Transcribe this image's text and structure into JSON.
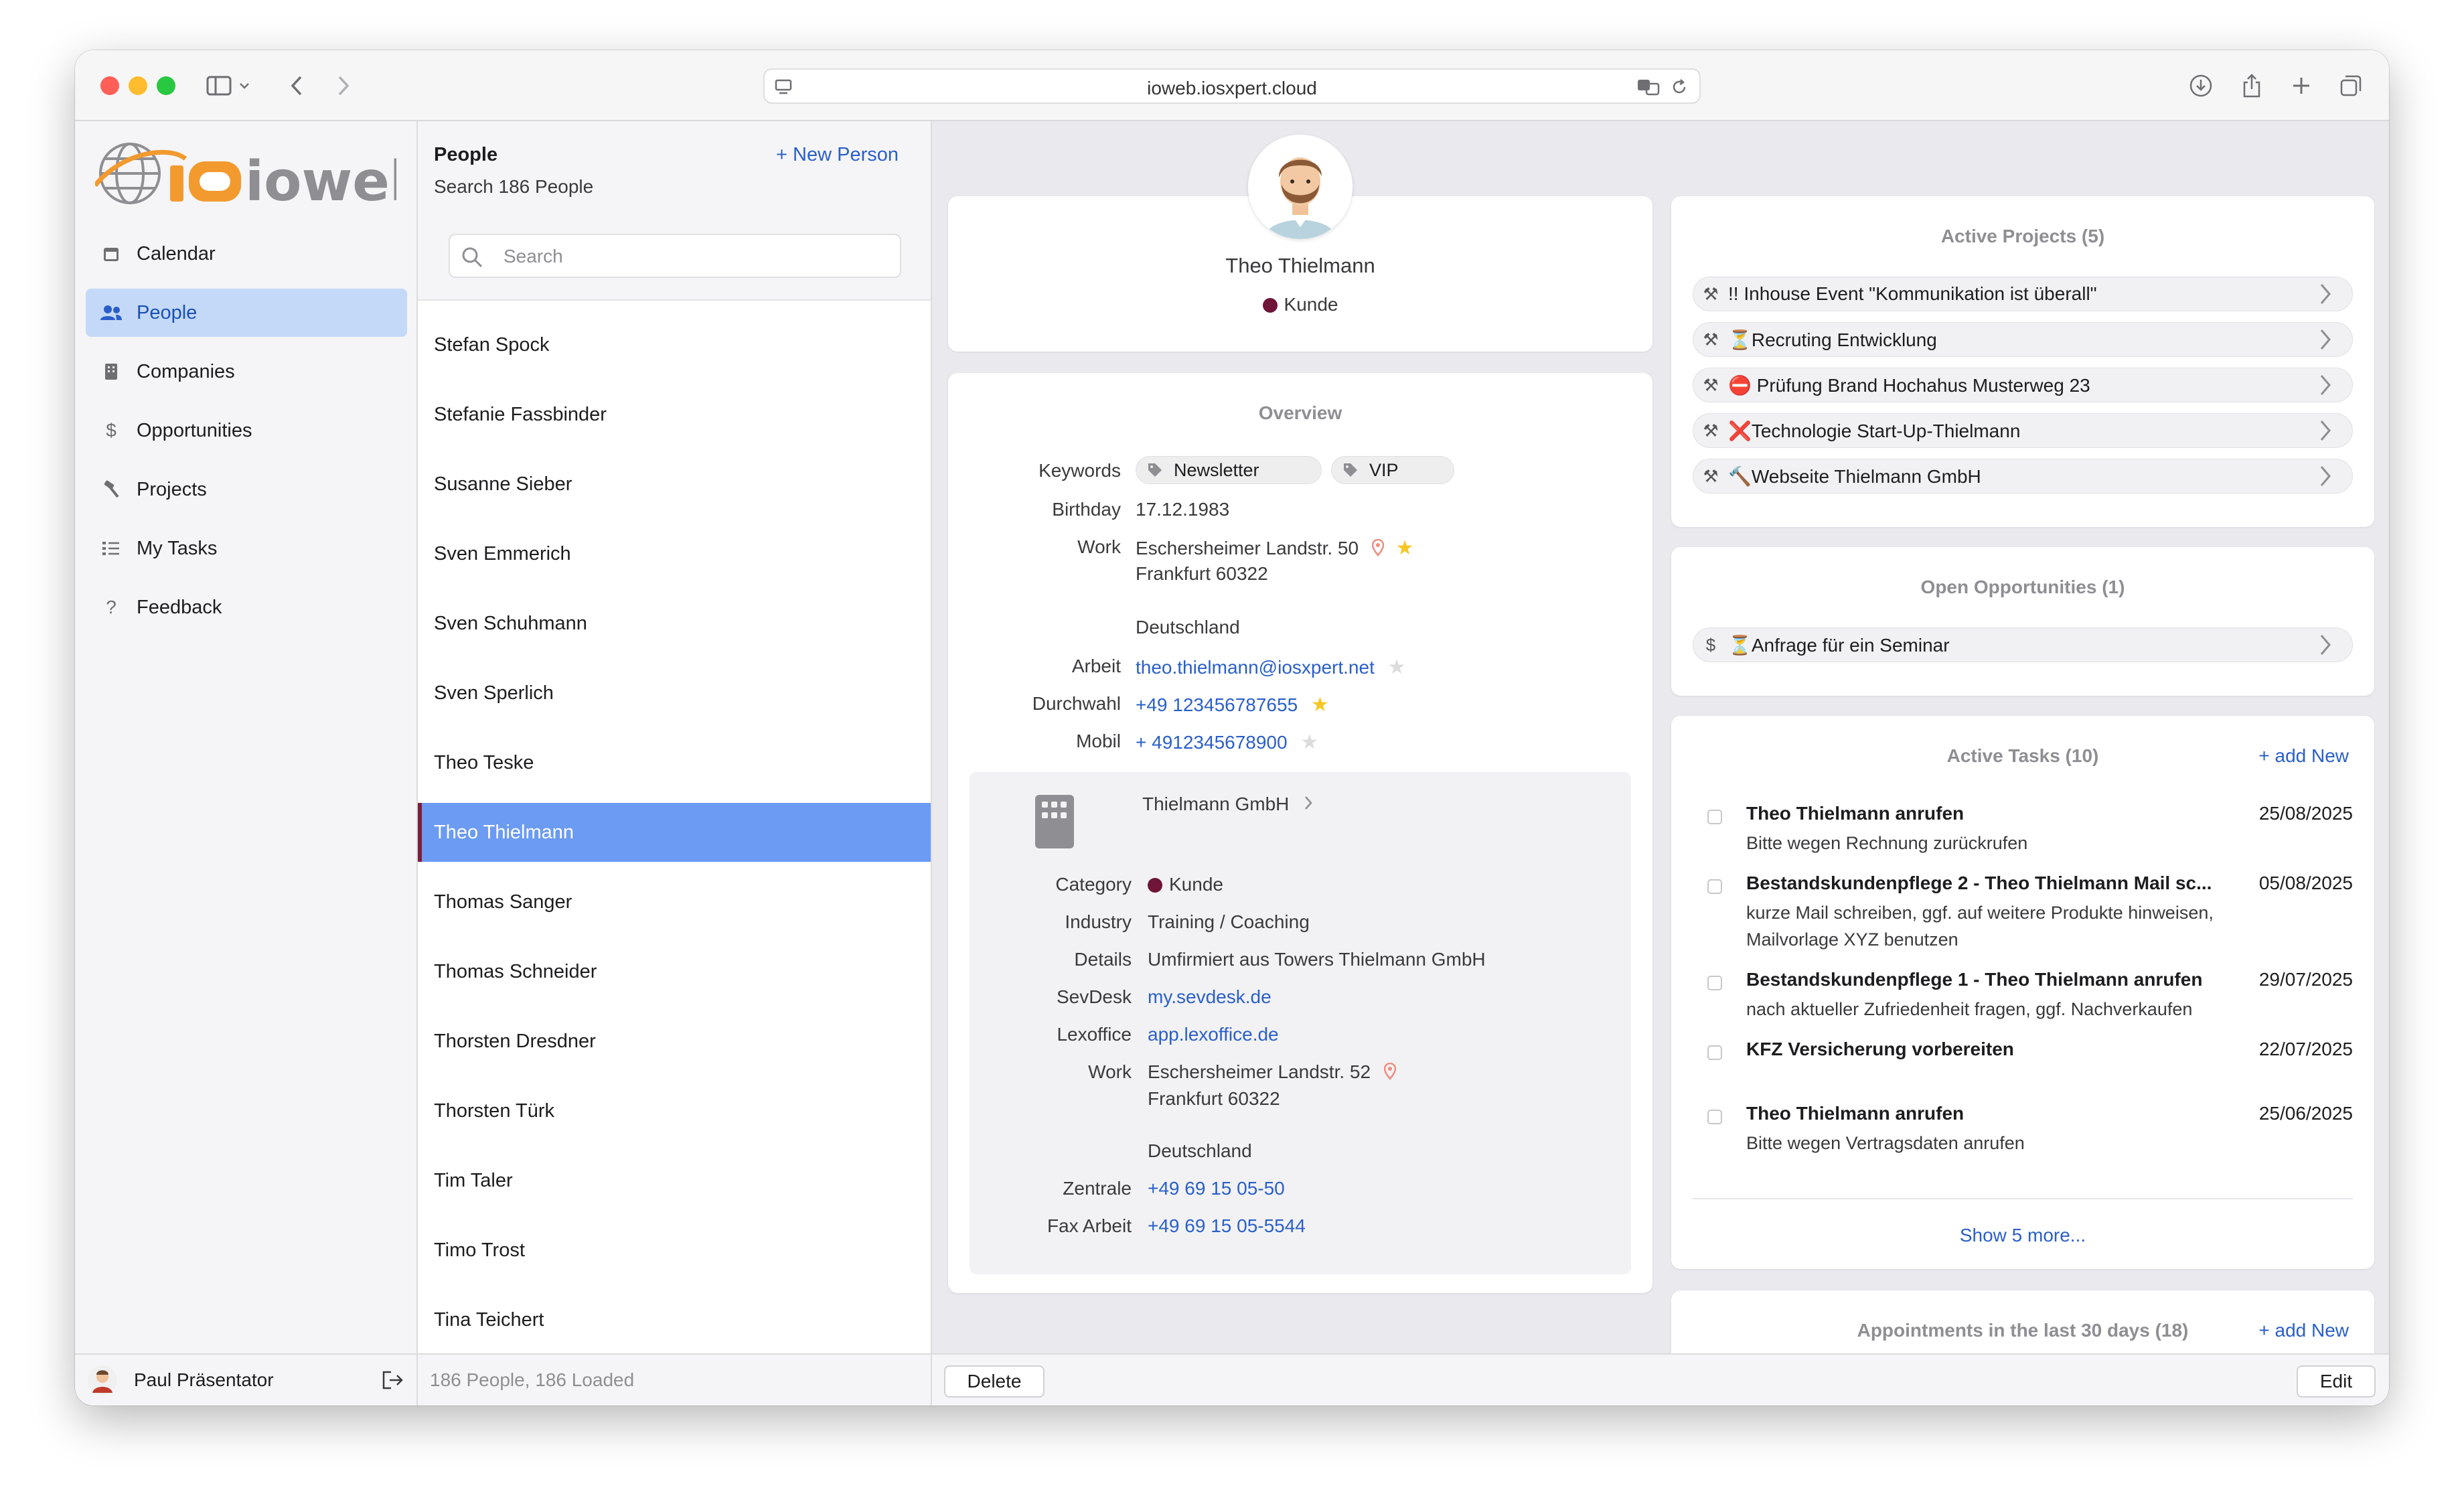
{
  "browser": {
    "url": "ioweb.iosxpert.cloud"
  },
  "sidebar": {
    "logo_text": "ioweb",
    "items": [
      {
        "label": "Calendar",
        "icon": "calendar-icon"
      },
      {
        "label": "People",
        "icon": "people-icon",
        "active": true
      },
      {
        "label": "Companies",
        "icon": "building-icon"
      },
      {
        "label": "Opportunities",
        "icon": "dollar-icon"
      },
      {
        "label": "Projects",
        "icon": "hammer-icon"
      },
      {
        "label": "My Tasks",
        "icon": "checklist-icon"
      },
      {
        "label": "Feedback",
        "icon": "question-icon"
      }
    ],
    "user_name": "Paul Präsentator"
  },
  "people_list": {
    "title": "People",
    "new_person_label": "+ New Person",
    "subtitle": "Search 186 People",
    "search_placeholder": "Search",
    "rows": [
      "Stefan Spock",
      "Stefanie Fassbinder",
      "Susanne Sieber",
      "Sven Emmerich",
      "Sven Schuhmann",
      "Sven Sperlich",
      "Theo Teske",
      "Theo Thielmann",
      "Thomas Sanger",
      "Thomas Schneider",
      "Thorsten Dresdner",
      "Thorsten Türk",
      "Tim Taler",
      "Timo Trost",
      "Tina Teichert"
    ],
    "selected": "Theo Thielmann",
    "footer": "186 People, 186 Loaded"
  },
  "person": {
    "name": "Theo Thielmann",
    "category": "Kunde",
    "category_color": "#6e1538"
  },
  "overview": {
    "title": "Overview",
    "keywords_label": "Keywords",
    "keywords": [
      "Newsletter",
      "VIP"
    ],
    "birthday_label": "Birthday",
    "birthday": "17.12.1983",
    "work_label": "Work",
    "work_street": "Eschersheimer Landstr. 50",
    "work_city": "Frankfurt 60322",
    "work_country": "Deutschland",
    "arbeit_label": "Arbeit",
    "arbeit_email": "theo.thielmann@iosxpert.net",
    "durchwahl_label": "Durchwahl",
    "durchwahl": "+49 123456787655",
    "mobil_label": "Mobil",
    "mobil": "+ 4912345678900"
  },
  "company": {
    "name": "Thielmann GmbH",
    "category_label": "Category",
    "category": "Kunde",
    "industry_label": "Industry",
    "industry": "Training / Coaching",
    "details_label": "Details",
    "details": "Umfirmiert aus Towers Thielmann GmbH",
    "sevdesk_label": "SevDesk",
    "sevdesk": "my.sevdesk.de",
    "lexoffice_label": "Lexoffice",
    "lexoffice": "app.lexoffice.de",
    "work_label": "Work",
    "work_street": "Eschersheimer Landstr. 52",
    "work_city": "Frankfurt 60322",
    "work_country": "Deutschland",
    "zentrale_label": "Zentrale",
    "zentrale": "+49 69 15 05-50",
    "fax_label": "Fax Arbeit",
    "fax": "+49 69 15 05-5544"
  },
  "active_projects": {
    "title": "Active Projects (5)",
    "items": [
      "!! Inhouse Event \"Kommunikation ist überall\"",
      "⏳Recruting Entwicklung",
      "⛔ Prüfung Brand Hochahus Musterweg 23",
      "❌Technologie Start-Up-Thielmann",
      "🔨Webseite Thielmann GmbH"
    ]
  },
  "open_opportunities": {
    "title": "Open Opportunities (1)",
    "items": [
      "⏳Anfrage für ein Seminar"
    ]
  },
  "active_tasks": {
    "title": "Active Tasks (10)",
    "add_label": "+ add New",
    "items": [
      {
        "title": "Theo Thielmann anrufen",
        "date": "25/08/2025",
        "subtitle": "Bitte wegen Rechnung zurückrufen"
      },
      {
        "title": "Bestandskundenpflege 2 - Theo Thielmann Mail sc...",
        "date": "05/08/2025",
        "subtitle": "kurze Mail schreiben, ggf. auf weitere Produkte hinweisen, Mailvorlage XYZ benutzen"
      },
      {
        "title": "Bestandskundenpflege 1 - Theo Thielmann anrufen",
        "date": "29/07/2025",
        "subtitle": "nach aktueller Zufriedenheit fragen, ggf. Nachverkaufen"
      },
      {
        "title": "KFZ Versicherung vorbereiten",
        "date": "22/07/2025",
        "subtitle": ""
      },
      {
        "title": "Theo Thielmann anrufen",
        "date": "25/06/2025",
        "subtitle": "Bitte wegen Vertragsdaten anrufen"
      }
    ],
    "show_more": "Show 5 more..."
  },
  "appointments": {
    "title": "Appointments in the last 30 days (18)",
    "add_label": "+ add New"
  },
  "footer": {
    "delete_label": "Delete",
    "edit_label": "Edit"
  }
}
